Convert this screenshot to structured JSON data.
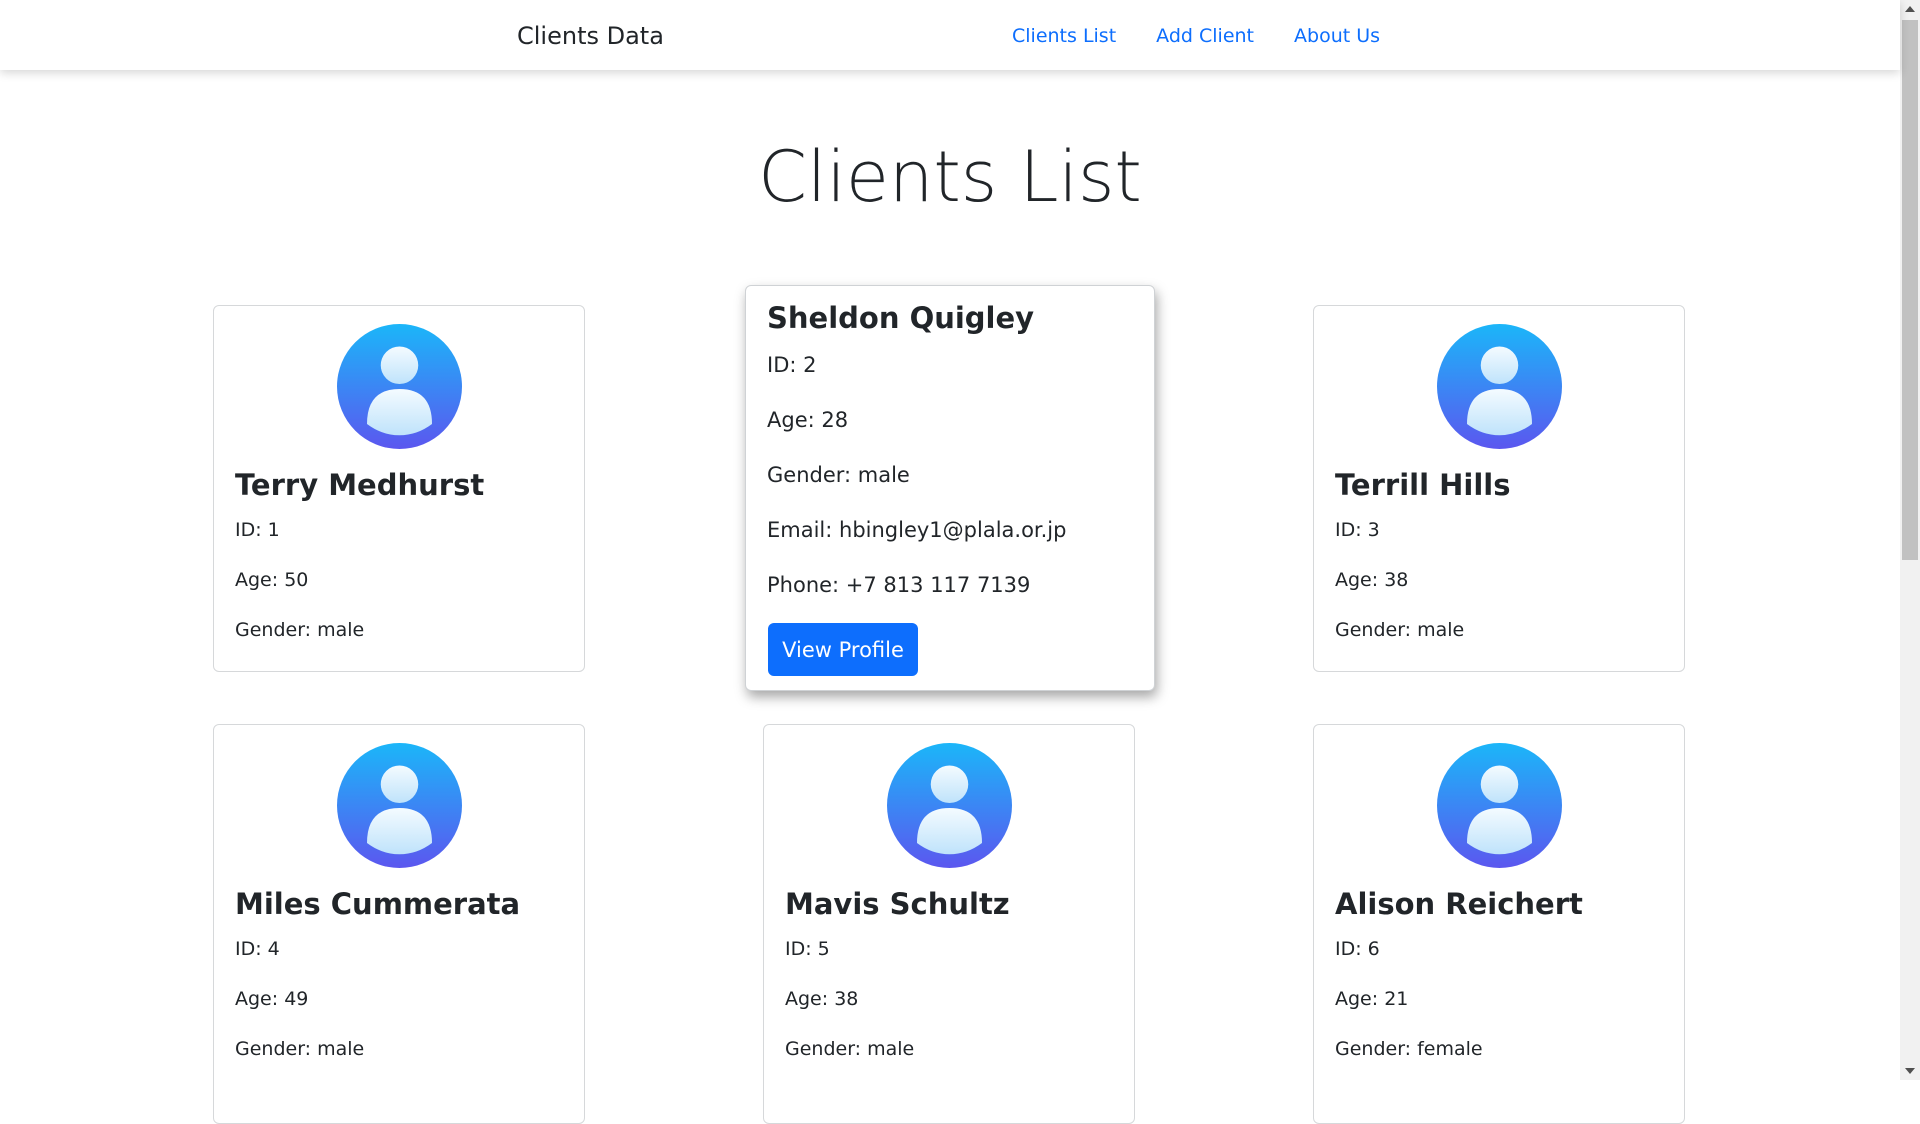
{
  "navbar": {
    "brand": "Clients Data",
    "links": [
      "Clients List",
      "Add Client",
      "About Us"
    ]
  },
  "page": {
    "title": "Clients List"
  },
  "colors": {
    "link": "#0d6efd",
    "button": "#0d6efd",
    "avatar_top": "#1bb6f9",
    "avatar_bottom": "#5b57ef"
  },
  "cards": [
    {
      "name": "Terry Medhurst",
      "id": "ID: 1",
      "age": "Age: 50",
      "gender": "Gender: male"
    },
    {
      "name": "Sheldon Quigley",
      "id": "ID: 2",
      "age": "Age: 28",
      "gender": "Gender: male",
      "email": "Email: hbingley1@plala.or.jp",
      "phone": "Phone: +7 813 117 7139",
      "button": "View Profile"
    },
    {
      "name": "Terrill Hills",
      "id": "ID: 3",
      "age": "Age: 38",
      "gender": "Gender: male"
    },
    {
      "name": "Miles Cummerata",
      "id": "ID: 4",
      "age": "Age: 49",
      "gender": "Gender: male"
    },
    {
      "name": "Mavis Schultz",
      "id": "ID: 5",
      "age": "Age: 38",
      "gender": "Gender: male"
    },
    {
      "name": "Alison Reichert",
      "id": "ID: 6",
      "age": "Age: 21",
      "gender": "Gender: female"
    }
  ],
  "icons": {
    "avatar": "user-avatar-icon"
  }
}
